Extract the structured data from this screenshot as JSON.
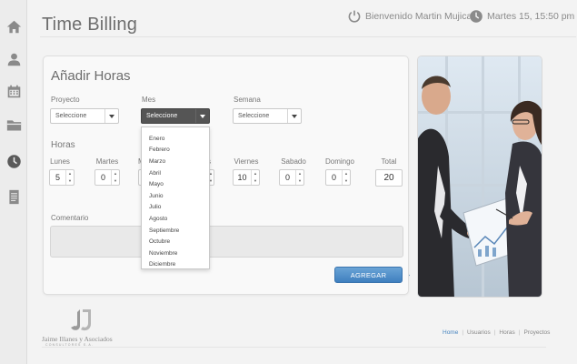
{
  "app": {
    "title": "Time Billing"
  },
  "header": {
    "welcome": "Bienvenido Martin Mujica",
    "datetime": "Martes 15, 15:50 pm"
  },
  "sidebar": {
    "icons": [
      "home-icon",
      "user-icon",
      "calendar-icon",
      "folder-icon",
      "clock-icon",
      "document-icon"
    ],
    "active": "clock-icon"
  },
  "form": {
    "title": "Añadir Horas",
    "proyecto": {
      "label": "Proyecto",
      "value": "Seleccione"
    },
    "mes": {
      "label": "Mes",
      "value": "Seleccione",
      "open": true
    },
    "semana": {
      "label": "Semana",
      "value": "Seleccione"
    },
    "horas_title": "Horas",
    "days": [
      {
        "label": "Lunes",
        "value": "5"
      },
      {
        "label": "Martes",
        "value": "0"
      },
      {
        "label": "Viernes",
        "value": "10"
      },
      {
        "label": "Sabado",
        "value": "0"
      },
      {
        "label": "Domingo",
        "value": "0"
      }
    ],
    "partial_day_labels": [
      "M",
      "s"
    ],
    "total": {
      "label": "Total",
      "value": "20"
    },
    "comment_label": "Comentario",
    "comment_value": "",
    "submit_label": "AGREGAR"
  },
  "mes_options": [
    "Enero",
    "Febrero",
    "Marzo",
    "Abril",
    "Mayo",
    "Junio",
    "Julio",
    "Agosto",
    "Septiembre",
    "Octubre",
    "Noviembre",
    "Diciembre"
  ],
  "footer": {
    "logo_name": "Jaime Illanes y Asociados",
    "logo_sub": "CONSULTORES S.A.",
    "nav": [
      "Home",
      "Usuarios",
      "Horas",
      "Proyectos"
    ],
    "nav_active": "Home"
  },
  "colors": {
    "accent": "#4a86c0",
    "button": "#3f7fbf"
  }
}
